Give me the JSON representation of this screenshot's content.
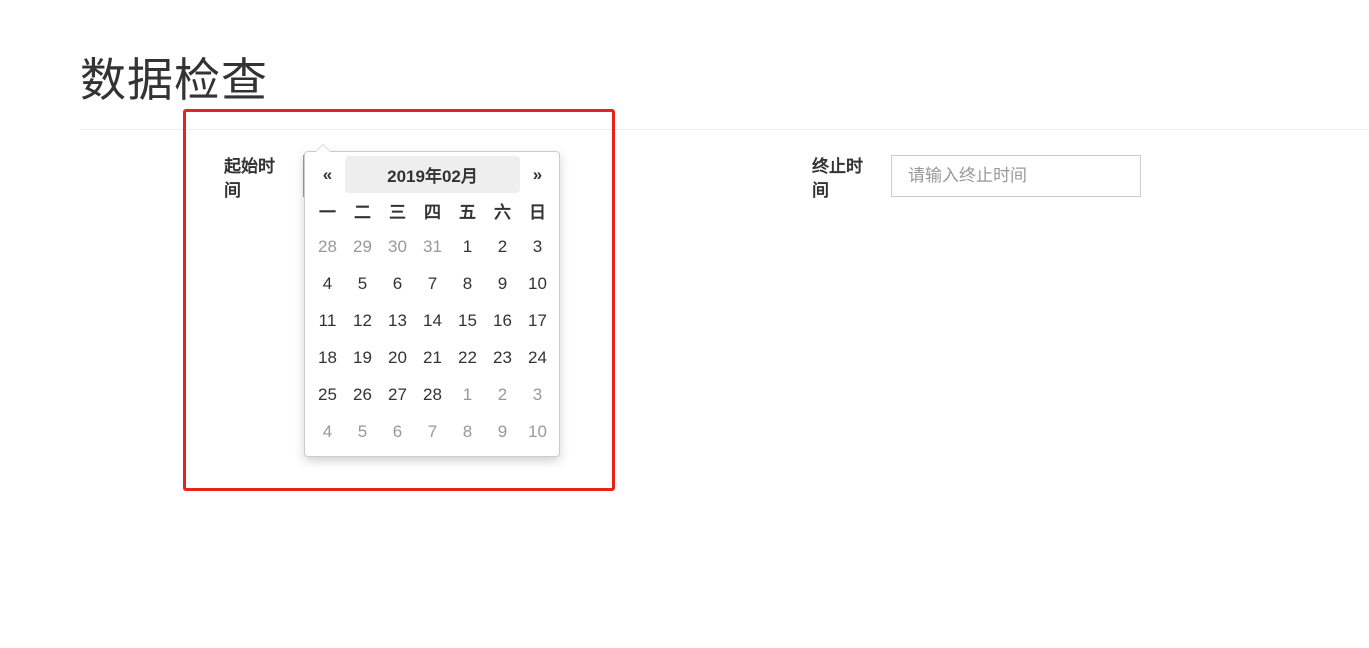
{
  "page": {
    "title": "数据检查"
  },
  "form": {
    "start_label": "起始时间",
    "end_label": "终止时间",
    "end_placeholder": "请输入终止时间"
  },
  "datepicker": {
    "prev_label": "«",
    "next_label": "»",
    "month_title": "2019年02月",
    "weekdays": [
      "一",
      "二",
      "三",
      "四",
      "五",
      "六",
      "日"
    ],
    "weeks": [
      [
        {
          "d": "28",
          "muted": true
        },
        {
          "d": "29",
          "muted": true
        },
        {
          "d": "30",
          "muted": true
        },
        {
          "d": "31",
          "muted": true
        },
        {
          "d": "1",
          "muted": false
        },
        {
          "d": "2",
          "muted": false
        },
        {
          "d": "3",
          "muted": false
        }
      ],
      [
        {
          "d": "4",
          "muted": false
        },
        {
          "d": "5",
          "muted": false
        },
        {
          "d": "6",
          "muted": false
        },
        {
          "d": "7",
          "muted": false
        },
        {
          "d": "8",
          "muted": false
        },
        {
          "d": "9",
          "muted": false
        },
        {
          "d": "10",
          "muted": false
        }
      ],
      [
        {
          "d": "11",
          "muted": false
        },
        {
          "d": "12",
          "muted": false
        },
        {
          "d": "13",
          "muted": false
        },
        {
          "d": "14",
          "muted": false
        },
        {
          "d": "15",
          "muted": false
        },
        {
          "d": "16",
          "muted": false
        },
        {
          "d": "17",
          "muted": false
        }
      ],
      [
        {
          "d": "18",
          "muted": false
        },
        {
          "d": "19",
          "muted": false
        },
        {
          "d": "20",
          "muted": false
        },
        {
          "d": "21",
          "muted": false
        },
        {
          "d": "22",
          "muted": false
        },
        {
          "d": "23",
          "muted": false
        },
        {
          "d": "24",
          "muted": false
        }
      ],
      [
        {
          "d": "25",
          "muted": false
        },
        {
          "d": "26",
          "muted": false
        },
        {
          "d": "27",
          "muted": false
        },
        {
          "d": "28",
          "muted": false
        },
        {
          "d": "1",
          "muted": true
        },
        {
          "d": "2",
          "muted": true
        },
        {
          "d": "3",
          "muted": true
        }
      ],
      [
        {
          "d": "4",
          "muted": true
        },
        {
          "d": "5",
          "muted": true
        },
        {
          "d": "6",
          "muted": true
        },
        {
          "d": "7",
          "muted": true
        },
        {
          "d": "8",
          "muted": true
        },
        {
          "d": "9",
          "muted": true
        },
        {
          "d": "10",
          "muted": true
        }
      ]
    ]
  },
  "colors": {
    "highlight_border": "#e8231c",
    "muted_day": "#999999",
    "switch_bg": "#eeeeee"
  }
}
